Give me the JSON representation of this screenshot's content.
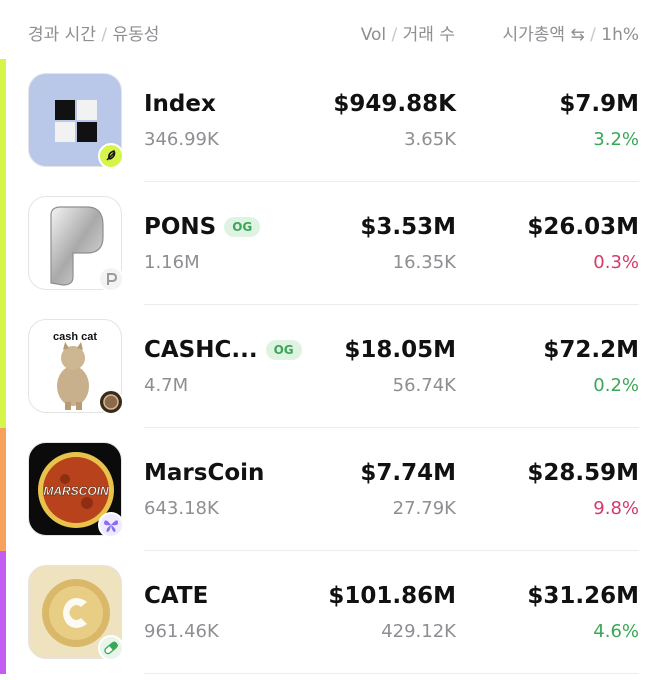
{
  "header": {
    "col1": "경과 시간",
    "col1b": "유동성",
    "col2": "Vol",
    "col2b": "거래 수",
    "col3": "시가총액",
    "col3b": "1h%",
    "separator": "/",
    "swap_glyph": "⇆"
  },
  "colors": {
    "up": "#3aa757",
    "down": "#d63a6a",
    "accent_lime": "#d6f54a",
    "accent_orange": "#f7a25a",
    "accent_purple": "#c35cf2"
  },
  "tokens": [
    {
      "name": "Index",
      "og": "",
      "liquidity": "346.99K",
      "volume": "$949.88K",
      "txns": "3.65K",
      "market_cap": "$7.9M",
      "change_1h": "3.2%",
      "change_dir": "up",
      "accent": "lime",
      "badge_icon": "feather-icon"
    },
    {
      "name": "PONS",
      "og": "OG",
      "liquidity": "1.16M",
      "volume": "$3.53M",
      "txns": "16.35K",
      "market_cap": "$26.03M",
      "change_1h": "0.3%",
      "change_dir": "down",
      "accent": "lime",
      "badge_icon": "p-letter-icon"
    },
    {
      "name": "CASHC...",
      "og": "OG",
      "liquidity": "4.7M",
      "volume": "$18.05M",
      "txns": "56.74K",
      "market_cap": "$72.2M",
      "change_1h": "0.2%",
      "change_dir": "up",
      "accent": "lime",
      "badge_icon": "coin-icon",
      "logo_text": "cash cat"
    },
    {
      "name": "MarsCoin",
      "og": "",
      "liquidity": "643.18K",
      "volume": "$7.74M",
      "txns": "27.79K",
      "market_cap": "$28.59M",
      "change_1h": "9.8%",
      "change_dir": "down",
      "accent": "orange",
      "badge_icon": "butterfly-icon",
      "logo_text": "MARSCOIN"
    },
    {
      "name": "CATE",
      "og": "",
      "liquidity": "961.46K",
      "volume": "$101.86M",
      "txns": "429.12K",
      "market_cap": "$31.26M",
      "change_1h": "4.6%",
      "change_dir": "up",
      "accent": "purple",
      "badge_icon": "pill-icon"
    }
  ]
}
